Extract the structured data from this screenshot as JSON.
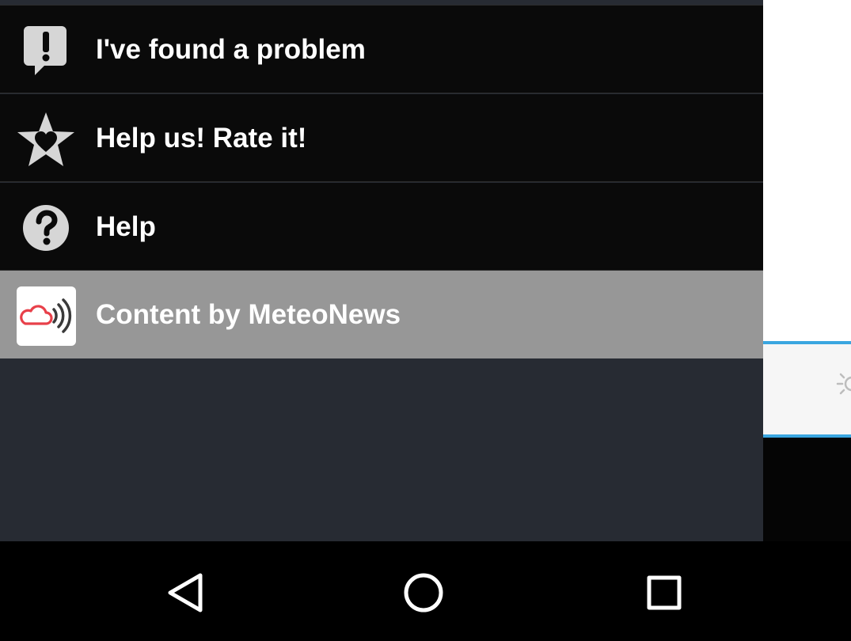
{
  "drawer": {
    "items": [
      {
        "label": "I've found a problem",
        "icon": "exclamation-bubble-icon"
      },
      {
        "label": "Help us! Rate it!",
        "icon": "star-heart-icon"
      },
      {
        "label": "Help",
        "icon": "question-circle-icon"
      },
      {
        "label": "Content by MeteoNews",
        "icon": "meteonews-logo-icon",
        "selected": true
      }
    ]
  },
  "navbar": {
    "buttons": [
      {
        "icon": "back-triangle-icon"
      },
      {
        "icon": "home-circle-icon"
      },
      {
        "icon": "recents-square-icon"
      }
    ]
  },
  "colors": {
    "drawer_item_bg": "#0a0a0a",
    "drawer_empty_bg": "#272b33",
    "selected_bg": "#979797",
    "accent_blue": "#3aa6e0",
    "meteonews_red": "#e8404a"
  }
}
